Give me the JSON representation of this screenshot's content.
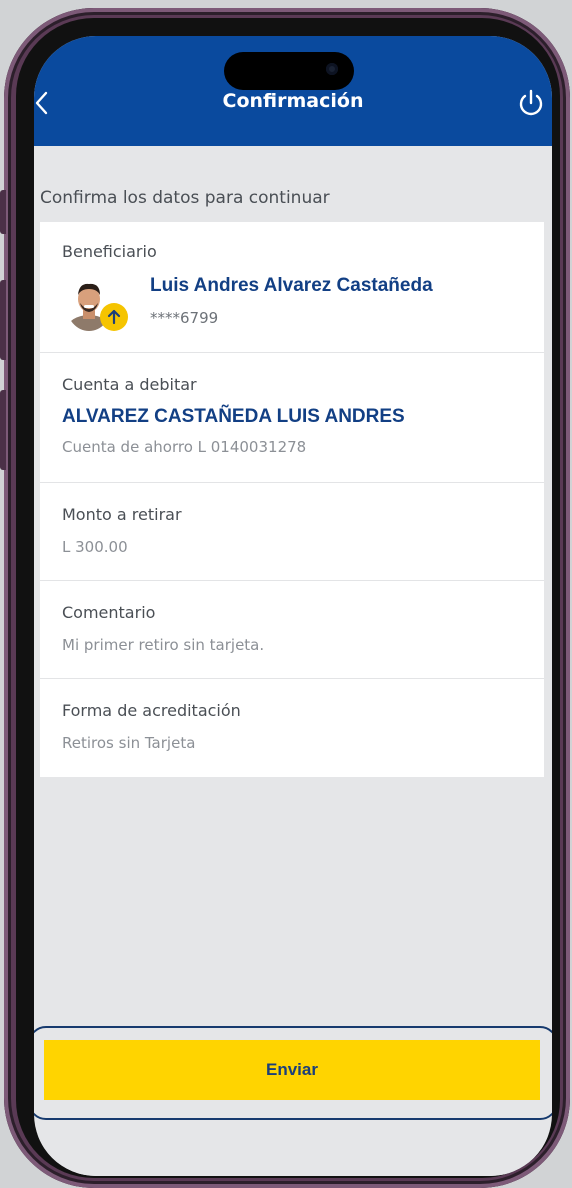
{
  "header": {
    "title": "Confirmación",
    "back_icon": "chevron-left-icon",
    "power_icon": "power-icon",
    "background_color": "#0a4a9e"
  },
  "subtitle": "Confirma los datos para continuar",
  "beneficiary": {
    "label": "Beneficiario",
    "name": "Luis Andres Alvarez Castañeda",
    "account": "****6799",
    "badge_icon": "arrow-up-icon"
  },
  "debit_account": {
    "label": "Cuenta a debitar",
    "holder": "ALVAREZ CASTAÑEDA LUIS ANDRES",
    "detail": "Cuenta de ahorro L 0140031278"
  },
  "amount": {
    "label": "Monto a retirar",
    "value": "L 300.00"
  },
  "comment": {
    "label": "Comentario",
    "value": "Mi primer retiro sin tarjeta."
  },
  "credit_method": {
    "label": "Forma de acreditación",
    "value": "Retiros sin Tarjeta"
  },
  "actions": {
    "send_label": "Enviar",
    "button_color": "#ffd400"
  }
}
